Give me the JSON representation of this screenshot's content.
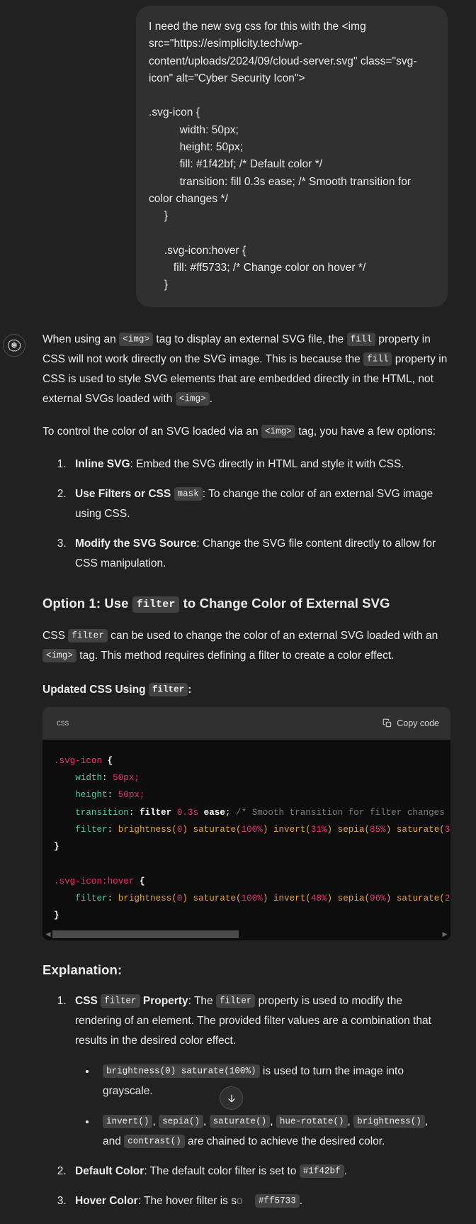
{
  "theme": {
    "page_bg": "#212121",
    "user_bubble_bg": "#303030",
    "code_block_bg": "#0d0d0d",
    "code_header_bg": "#303030",
    "inline_chip_bg": "#424242",
    "text_color": "#ececec"
  },
  "user_message": {
    "text": "I need the new svg css for this with the <img src=\"https://esimplicity.tech/wp-content/uploads/2024/09/cloud-server.svg\" class=\"svg-icon\" alt=\"Cyber Security Icon\">\n\n.svg-icon {\n          width: 50px;\n          height: 50px;\n          fill: #1f42bf; /* Default color */\n          transition: fill 0.3s ease; /* Smooth transition for color changes */\n     }\n\n     .svg-icon:hover {\n        fill: #ff5733; /* Change color on hover */\n     }"
  },
  "assistant": {
    "avatar_icon": "openai-logo-icon",
    "intro_p1": {
      "a": "When using an ",
      "code1": "<img>",
      "b": " tag to display an external SVG file, the ",
      "code2": "fill",
      "c": " property in CSS will not work directly on the SVG image. This is because the ",
      "code3": "fill",
      "d": " property in CSS is used to style SVG elements that are embedded directly in the HTML, not external SVGs loaded with ",
      "code4": "<img>",
      "e": "."
    },
    "intro_p2": {
      "a": "To control the color of an SVG loaded via an ",
      "code1": "<img>",
      "b": " tag, you have a few options:"
    },
    "options": [
      {
        "bold": "Inline SVG",
        "rest": ": Embed the SVG directly in HTML and style it with CSS."
      },
      {
        "bold": "Use Filters or CSS ",
        "code": "mask",
        "rest": ": To change the color of an external SVG image using CSS."
      },
      {
        "bold": "Modify the SVG Source",
        "rest": ": Change the SVG file content directly to allow for CSS manipulation."
      }
    ],
    "option1_heading": {
      "a": "Option 1: Use ",
      "code": "filter",
      "b": " to Change Color of External SVG"
    },
    "option1_paragraph": {
      "a": "CSS ",
      "code1": "filter",
      "b": " can be used to change the color of an external SVG loaded with an ",
      "code2": "<img>",
      "c": " tag. This method requires defining a filter to create a color effect."
    },
    "updated_css_label": {
      "a": "Updated CSS Using ",
      "code": "filter",
      "b": ":"
    },
    "code_block": {
      "language": "css",
      "copy_label": "Copy code",
      "copy_icon": "copy-icon",
      "lines": [
        ".svg-icon {",
        "    width: 50px;",
        "    height: 50px;",
        "    transition: filter 0.3s ease; /* Smooth transition for filter changes",
        "    filter: brightness(0) saturate(100%) invert(31%) sepia(85%) saturate(3",
        "}",
        "",
        ".svg-icon:hover {",
        "    filter: brightness(0) saturate(100%) invert(48%) sepia(96%) saturate(2",
        "}"
      ],
      "scrollbar": {
        "left_arrow": "chevron-left-icon",
        "right_arrow": "chevron-right-icon"
      }
    },
    "explanation_heading": "Explanation:",
    "explanation_items": [
      {
        "bold_a": "CSS ",
        "code_a": "filter",
        "bold_b": " Property",
        "rest_a": ": The ",
        "code_b": "filter",
        "rest_b": " property is used to modify the rendering of an element. The provided filter values are a combination that results in the desired color effect.",
        "bullets": [
          {
            "code": "brightness(0) saturate(100%)",
            "rest": " is used to turn the image into grayscale."
          },
          {
            "codes": [
              "invert()",
              "sepia()",
              "saturate()",
              "hue-rotate()",
              "brightness()"
            ],
            "mid": ", and ",
            "code_last": "contrast()",
            "rest": " are chained to achieve the desired color."
          }
        ]
      },
      {
        "bold": "Default Color",
        "rest_a": ": The default color filter is set to ",
        "code": "#1f42bf",
        "rest_b": "."
      },
      {
        "bold": "Hover Color",
        "rest_a": ": The hover filter is s",
        "hidden_mid": "o",
        "code": "#ff5733",
        "rest_b": "."
      }
    ]
  },
  "scroll_to_bottom_button": {
    "icon": "arrow-down-icon",
    "label": "Scroll to bottom"
  }
}
